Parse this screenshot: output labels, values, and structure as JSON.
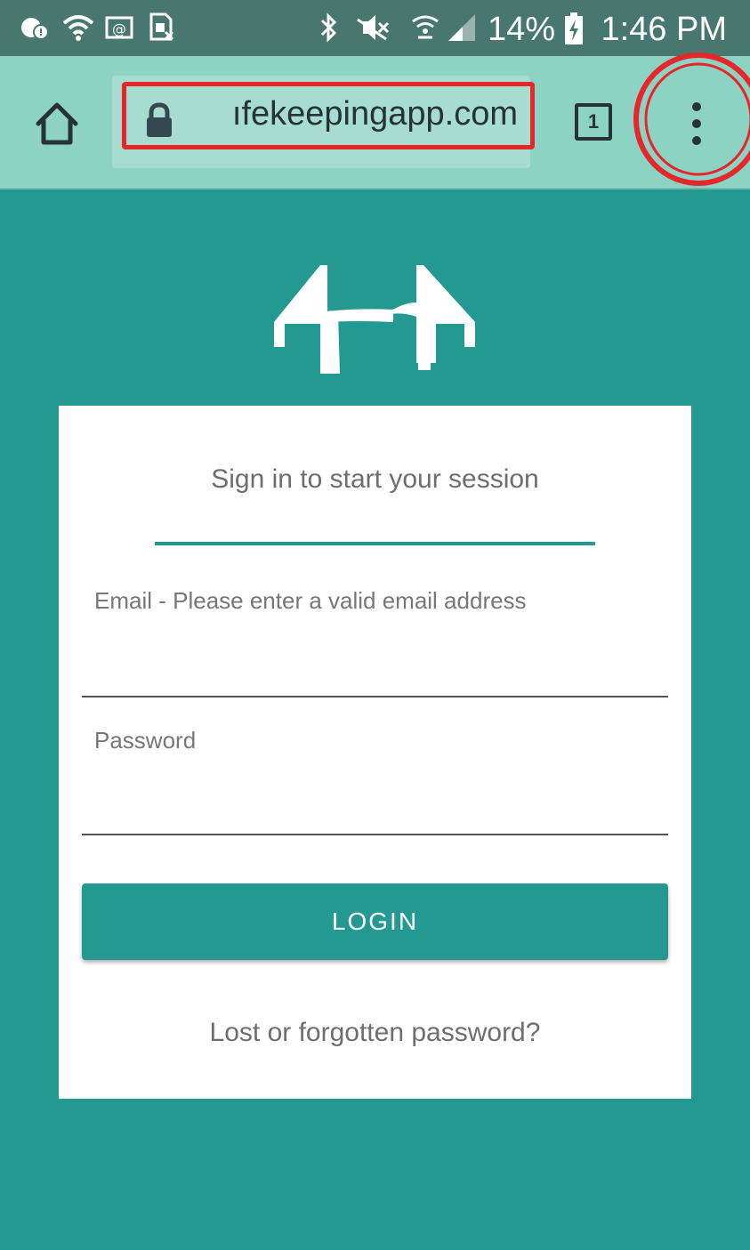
{
  "status_bar": {
    "battery_percent": "14%",
    "time": "1:46 PM",
    "icons": [
      "notification-icon",
      "wifi-icon",
      "email-icon",
      "sim-icon",
      "bluetooth-icon",
      "mute-icon",
      "wifi-calling-icon",
      "signal-icon",
      "battery-charging-icon"
    ]
  },
  "browser": {
    "url": "ıfekeepingapp.com",
    "tab_count": "1",
    "highlight_color": "#e5262b"
  },
  "login_card": {
    "title": "Sign in to start your session",
    "email_label": "Email - Please enter a valid email address",
    "email_value": "",
    "password_label": "Password",
    "password_value": "",
    "login_button": "LOGIN",
    "forgot_link": "Lost or forgotten password?"
  },
  "colors": {
    "accent": "#249991",
    "toolbar": "#8dd3c4",
    "status_bar": "#47776f"
  }
}
